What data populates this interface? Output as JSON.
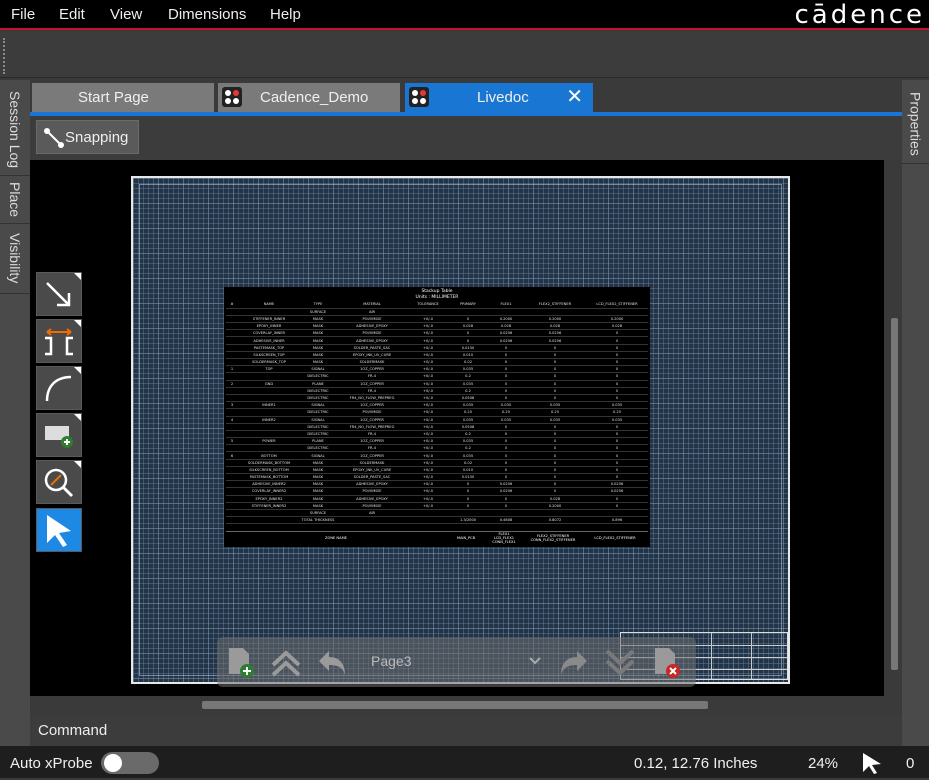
{
  "menu": {
    "items": [
      "File",
      "Edit",
      "View",
      "Dimensions",
      "Help"
    ]
  },
  "brand": "cādence",
  "left_rail": {
    "tabs": [
      "Session Log",
      "Place",
      "Visibility"
    ]
  },
  "right_rail": {
    "tabs": [
      "Properties"
    ]
  },
  "tabs": [
    {
      "label": "Start Page",
      "icon": ""
    },
    {
      "label": "Cadence_Demo",
      "icon": "design-file-icon"
    },
    {
      "label": "Livedoc",
      "icon": "design-file-icon",
      "active": true,
      "closable": true
    }
  ],
  "toolbar": {
    "snapping_label": "Snapping"
  },
  "side_tools": [
    "arrow-line-icon",
    "dimension-icon",
    "arc-icon",
    "add-view-icon",
    "zoom-fit-icon",
    "select-pointer-icon"
  ],
  "stackup": {
    "title": "Stackup Table",
    "units": "Units : MILLIMETER",
    "headers": [
      "#",
      "NAME",
      "TYPE",
      "MATERIAL",
      "TOLERANCE",
      "PRIMARY",
      "FLEX1",
      "FLEX2_STIFFENER",
      "LCD_FLEX2_STIFFENER"
    ],
    "rows": [
      [
        "",
        "",
        "SURFACE",
        "AIR",
        "",
        "",
        "",
        "",
        ""
      ],
      [
        "",
        "STIFFENER_INNER",
        "MASK",
        "POLYIMIDE",
        "+0/-0",
        "0",
        "0.2000",
        "0.2000",
        "0.2000"
      ],
      [
        "",
        "EPOXY_INNER",
        "MASK",
        "ADHESIVE_EPOXY",
        "+0/-0",
        "0.028",
        "0.028",
        "0.028",
        "0.028"
      ],
      [
        "",
        "COVERLAY_INNER",
        "MASK",
        "POLYIMIDE",
        "+0/-0",
        "0",
        "0.0256",
        "0.0256",
        "0"
      ],
      [
        "",
        "ADHESIVE_INNER",
        "MASK",
        "ADHESIVE_EPOXY",
        "+0/-0",
        "0",
        "0.0256",
        "0.0256",
        "0"
      ],
      [
        "",
        "PASTEMASK_TOP",
        "MASK",
        "SOLDER_PASTE_SAC",
        "+0/-0",
        "0.0150",
        "0",
        "0",
        "0"
      ],
      [
        "",
        "SILKSCREEN_TOP",
        "MASK",
        "EPOXY_INK_UV_CURE",
        "+0/-0",
        "0.010",
        "0",
        "0",
        "0"
      ],
      [
        "",
        "SOLDERMASK_TOP",
        "MASK",
        "SOLDERMASK",
        "+0/-0",
        "0.02",
        "0",
        "0",
        "0"
      ],
      [
        "1",
        "TOP",
        "SIGNAL",
        "1OZ_COPPER",
        "+0/-0",
        "0.035",
        "0",
        "0",
        "0"
      ],
      [
        "",
        "",
        "DIELECTRIC",
        "FR-4",
        "+0/-0",
        "0.2",
        "0",
        "0",
        "0"
      ],
      [
        "2",
        "GND",
        "PLANE",
        "1OZ_COPPER",
        "+0/-0",
        "0.035",
        "0",
        "0",
        "0"
      ],
      [
        "",
        "",
        "DIELECTRIC",
        "FR-4",
        "+0/-0",
        "0.2",
        "0",
        "0",
        "0"
      ],
      [
        "",
        "",
        "DIELECTRIC",
        "FR4_NO_FLOW_PREPREG",
        "+0/-0",
        "0.0508",
        "0",
        "0",
        "0"
      ],
      [
        "3",
        "INNER1",
        "SIGNAL",
        "1OZ_COPPER",
        "+0/-0",
        "0.035",
        "0.035",
        "0.035",
        "0.035"
      ],
      [
        "",
        "",
        "DIELECTRIC",
        "POLYIMIDE",
        "+0/-0",
        "0.25",
        "0.25",
        "0.25",
        "0.25"
      ],
      [
        "4",
        "INNER2",
        "SIGNAL",
        "1OZ_COPPER",
        "+0/-0",
        "0.035",
        "0.035",
        "0.035",
        "0.035"
      ],
      [
        "",
        "",
        "DIELECTRIC",
        "FR4_NO_FLOW_PREPREG",
        "+0/-0",
        "0.0508",
        "0",
        "0",
        "0"
      ],
      [
        "",
        "",
        "DIELECTRIC",
        "FR-4",
        "+0/-0",
        "0.2",
        "0",
        "0",
        "0"
      ],
      [
        "5",
        "POWER",
        "PLANE",
        "1OZ_COPPER",
        "+0/-0",
        "0.035",
        "0",
        "0",
        "0"
      ],
      [
        "",
        "",
        "DIELECTRIC",
        "FR-4",
        "+0/-0",
        "0.2",
        "0",
        "0",
        "0"
      ],
      [
        "6",
        "BOTTOM",
        "SIGNAL",
        "1OZ_COPPER",
        "+0/-0",
        "0.035",
        "0",
        "0",
        "0"
      ],
      [
        "",
        "SOLDERMASK_BOTTOM",
        "MASK",
        "SOLDERMASK",
        "+0/-0",
        "0.02",
        "0",
        "0",
        "0"
      ],
      [
        "",
        "SILKSCREEN_BOTTOM",
        "MASK",
        "EPOXY_INK_UV_CURE",
        "+0/-0",
        "0.010",
        "0",
        "0",
        "0"
      ],
      [
        "",
        "PASTEMASK_BOTTOM",
        "MASK",
        "SOLDER_PASTE_SAC",
        "+0/-0",
        "0.0150",
        "0",
        "0",
        "0"
      ],
      [
        "",
        "ADHESIVE_INNER2",
        "MASK",
        "ADHESIVE_EPOXY",
        "+0/-0",
        "0",
        "0.0256",
        "0",
        "0.0256"
      ],
      [
        "",
        "COVERLAY_INNER2",
        "MASK",
        "POLYIMIDE",
        "+0/-0",
        "0",
        "0.0256",
        "0",
        "0.0256"
      ],
      [
        "",
        "EPOXY_INNER2",
        "MASK",
        "ADHESIVE_EPOXY",
        "+0/-0",
        "0",
        "0",
        "0.028",
        "0"
      ],
      [
        "",
        "STIFFENER_INNER2",
        "MASK",
        "POLYIMIDE",
        "+0/-0",
        "0",
        "0",
        "0.2000",
        "0"
      ],
      [
        "",
        "",
        "SURFACE",
        "AIR",
        "",
        "",
        "",
        "",
        ""
      ],
      [
        "",
        "",
        "TOTAL THICKNESS",
        "",
        "",
        "1.3/2000",
        "0.4608",
        "0.8072",
        "0.896"
      ]
    ],
    "zone_row": {
      "label": "ZONE NAME",
      "primary": "MAIN_PCB",
      "flex1": "FLEX1\nLCD_FLEX1\nCONN_FLEX1",
      "flex2": "FLEX2_STIFFENER\nCONN_FLEX2_STIFFENER",
      "lcd": "LCD_FLEX2_STIFFENER"
    }
  },
  "page_nav": {
    "current_page": "Page3"
  },
  "command": {
    "label": "Command"
  },
  "status": {
    "auto_xprobe_label": "Auto xProbe",
    "auto_xprobe_on": false,
    "coordinates": "0.12, 12.76 Inches",
    "zoom": "24%",
    "selected_count": "0"
  },
  "colors": {
    "accent": "#1976d2",
    "brand_red": "#c8102e",
    "sheet_bg": "#233447"
  }
}
